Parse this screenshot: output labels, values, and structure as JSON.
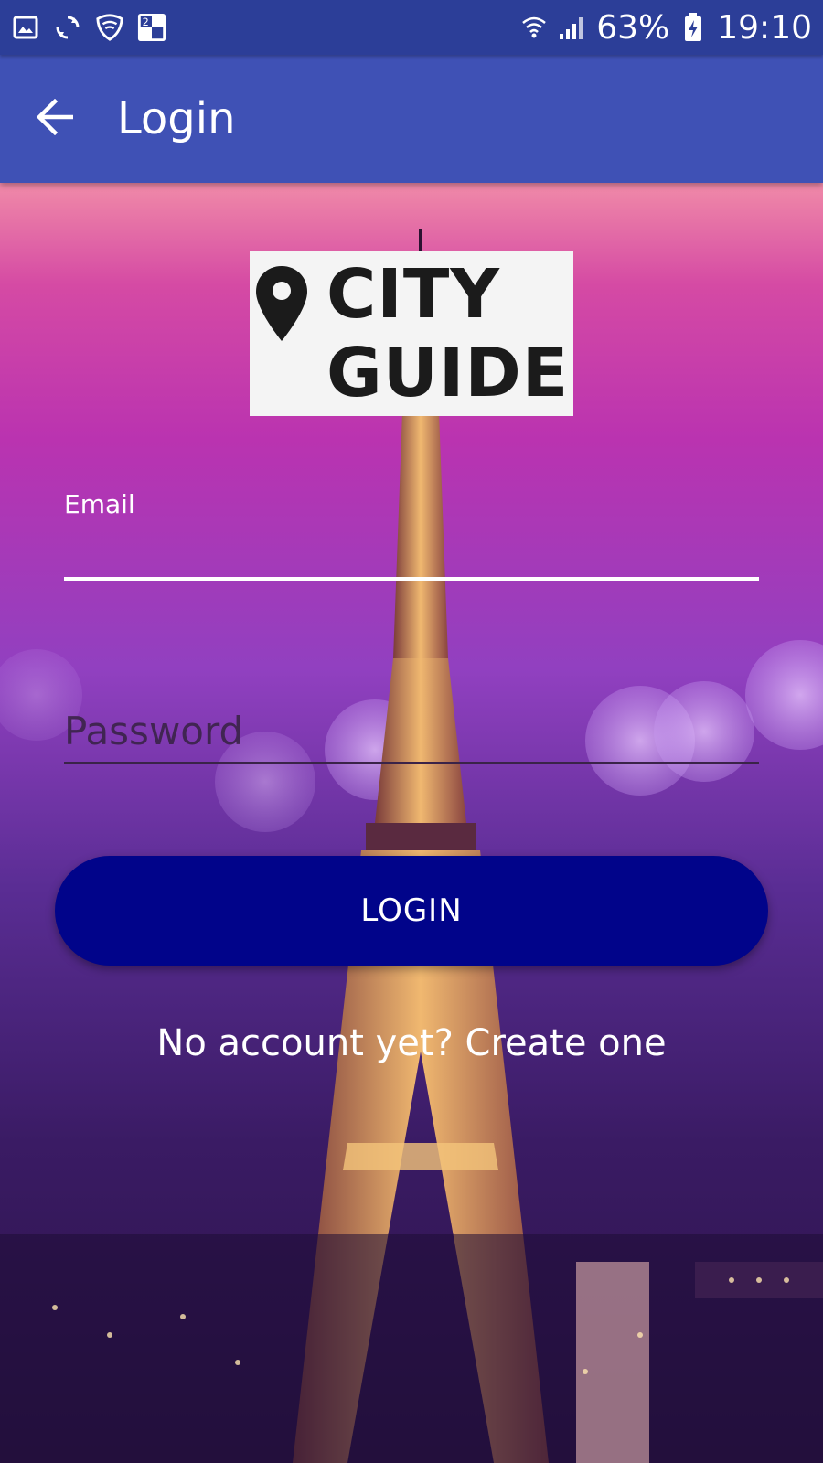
{
  "status_bar": {
    "battery": "63%",
    "time": "19:10",
    "icons_left": [
      "gallery-icon",
      "sync-icon",
      "shield-icon",
      "calendar-icon"
    ],
    "icons_right": [
      "wifi-icon",
      "signal-icon",
      "battery-icon"
    ]
  },
  "app_bar": {
    "title": "Login",
    "back_icon": "arrow-left-icon",
    "color": "#3f51b5"
  },
  "logo": {
    "line1": "CITY",
    "line2": "GUIDE",
    "icon": "map-pin-icon"
  },
  "form": {
    "email_label": "Email",
    "email_value": "",
    "password_placeholder": "Password",
    "login_label": "LOGIN",
    "login_color": "#01048a",
    "signup_text": "No account yet? Create one"
  }
}
